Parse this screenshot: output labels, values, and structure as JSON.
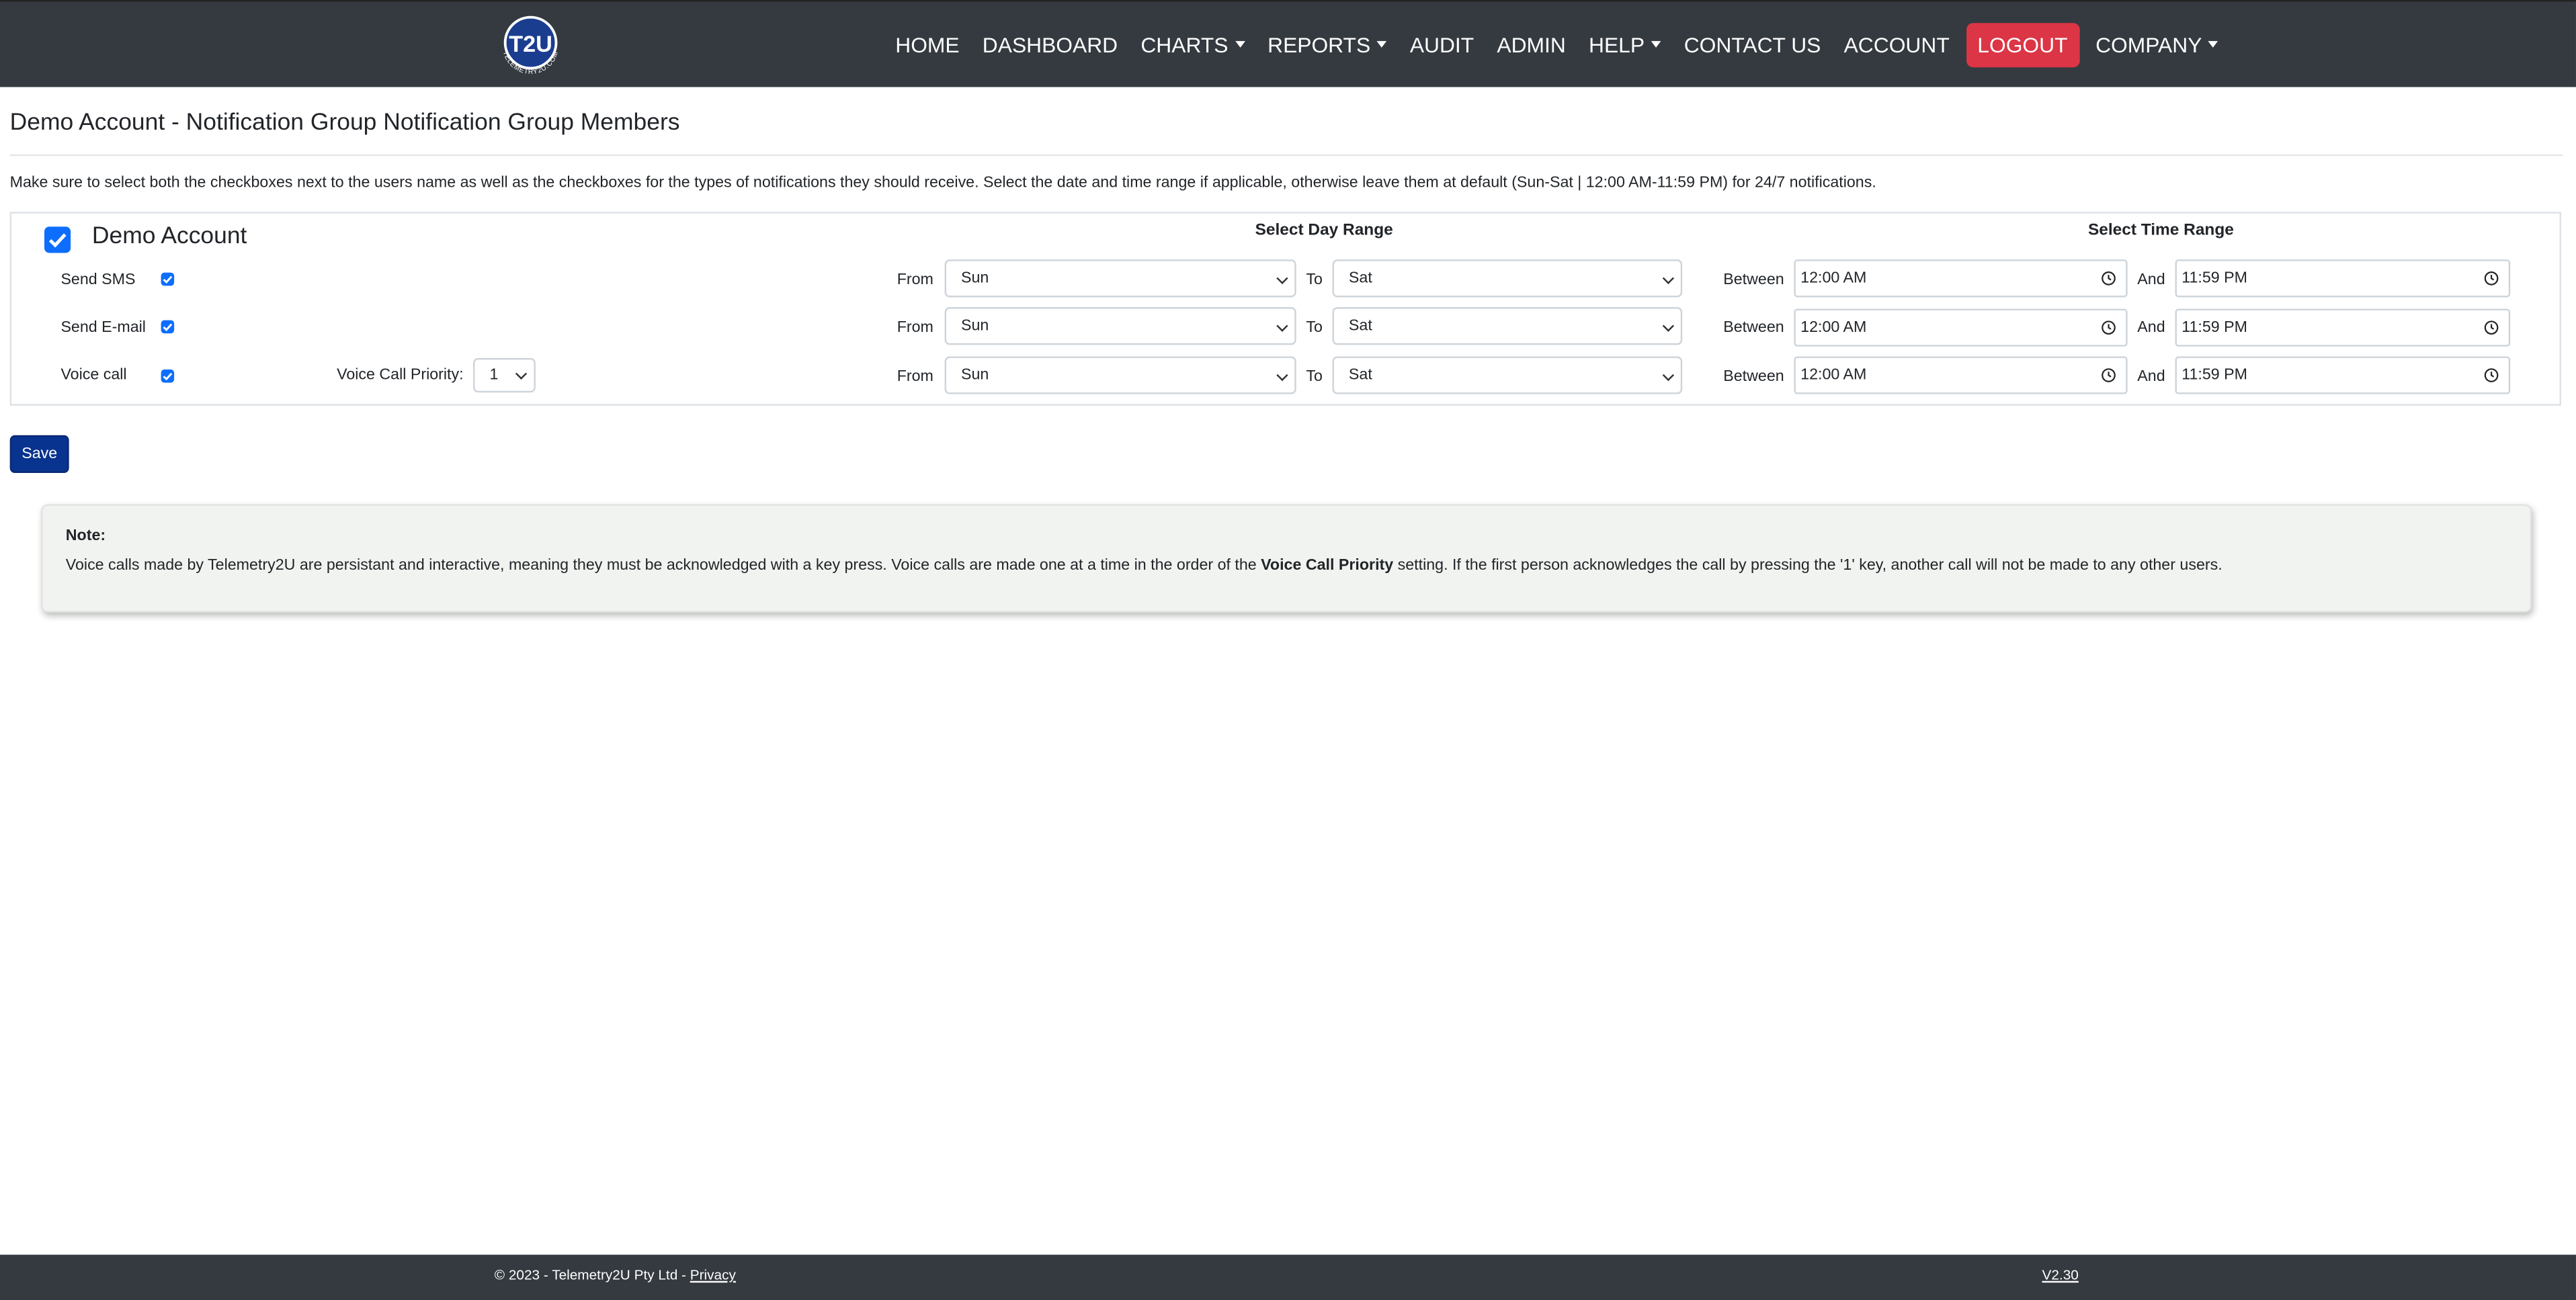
{
  "navbar": {
    "logo_text": "T2U",
    "logo_ring_text": "TELEMETRY2U.COM",
    "items": [
      {
        "label": "HOME",
        "dropdown": false
      },
      {
        "label": "DASHBOARD",
        "dropdown": false
      },
      {
        "label": "CHARTS",
        "dropdown": true
      },
      {
        "label": "REPORTS",
        "dropdown": true
      },
      {
        "label": "AUDIT",
        "dropdown": false
      },
      {
        "label": "ADMIN",
        "dropdown": false
      },
      {
        "label": "HELP",
        "dropdown": true
      },
      {
        "label": "CONTACT US",
        "dropdown": false
      },
      {
        "label": "ACCOUNT",
        "dropdown": false
      },
      {
        "label": "LOGOUT",
        "dropdown": false
      },
      {
        "label": "COMPANY",
        "dropdown": true
      }
    ],
    "logout_color": "#dc3545"
  },
  "page": {
    "title": "Demo Account - Notification Group Notification Group Members",
    "instructions": "Make sure to select both the checkboxes next to the users name as well as the checkboxes for the types of notifications they should receive. Select the date and time range if applicable, otherwise leave them at default (Sun-Sat | 12:00 AM-11:59 PM) for 24/7 notifications."
  },
  "member": {
    "name": "Demo Account",
    "checked": true,
    "day_range_heading": "Select Day Range",
    "time_range_heading": "Select Time Range",
    "voice_priority_label": "Voice Call Priority:",
    "voice_priority_value": "1",
    "rows": [
      {
        "label": "Send SMS",
        "checked": true,
        "from_label": "From",
        "from": "Sun",
        "to_label": "To",
        "to": "Sat",
        "between_label": "Between",
        "start": "12:00 AM",
        "and_label": "And",
        "end": "11:59 PM"
      },
      {
        "label": "Send E-mail",
        "checked": true,
        "from_label": "From",
        "from": "Sun",
        "to_label": "To",
        "to": "Sat",
        "between_label": "Between",
        "start": "12:00 AM",
        "and_label": "And",
        "end": "11:59 PM"
      },
      {
        "label": "Voice call",
        "checked": true,
        "from_label": "From",
        "from": "Sun",
        "to_label": "To",
        "to": "Sat",
        "between_label": "Between",
        "start": "12:00 AM",
        "and_label": "And",
        "end": "11:59 PM"
      }
    ]
  },
  "actions": {
    "save_label": "Save",
    "save_color": "#08338f"
  },
  "note": {
    "title": "Note:",
    "text_before": "Voice calls made by Telemetry2U are persistant and interactive, meaning they must be acknowledged with a key press. Voice calls are made one at a time in the order of the ",
    "text_bold": "Voice Call Priority",
    "text_after": " setting. If the first person acknowledges the call by pressing the '1' key, another call will not be made to any other users."
  },
  "footer": {
    "copyright": "© 2023 - Telemetry2U Pty Ltd - ",
    "privacy_label": "Privacy",
    "version": "V2.30"
  }
}
